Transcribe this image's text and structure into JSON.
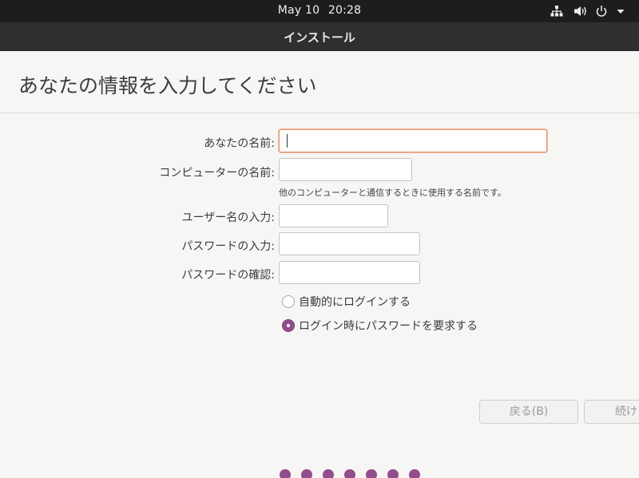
{
  "top_panel": {
    "date": "May 10",
    "time": "20:28",
    "icons": [
      "network-icon",
      "volume-icon",
      "power-icon",
      "system-menu-arrow-icon"
    ]
  },
  "window": {
    "title": "インストール"
  },
  "page": {
    "title": "あなたの情報を入力してください"
  },
  "form": {
    "name_label": "あなたの名前:",
    "name_value": "",
    "computer_label": "コンピューターの名前:",
    "computer_value": "",
    "computer_hint": "他のコンピューターと通信するときに使用する名前です。",
    "username_label": "ユーザー名の入力:",
    "username_value": "",
    "password_label": "パスワードの入力:",
    "password_value": "",
    "confirm_label": "パスワードの確認:",
    "confirm_value": ""
  },
  "login_options": [
    {
      "label": "自動的にログインする",
      "selected": false
    },
    {
      "label": "ログイン時にパスワードを要求する",
      "selected": true
    }
  ],
  "buttons": {
    "back": "戻る(B)",
    "continue": "続け"
  },
  "progress": {
    "total_steps": 7
  },
  "colors": {
    "accent": "#924d8b",
    "focus_border": "#e9936f",
    "panel": "#1d1d1d"
  }
}
